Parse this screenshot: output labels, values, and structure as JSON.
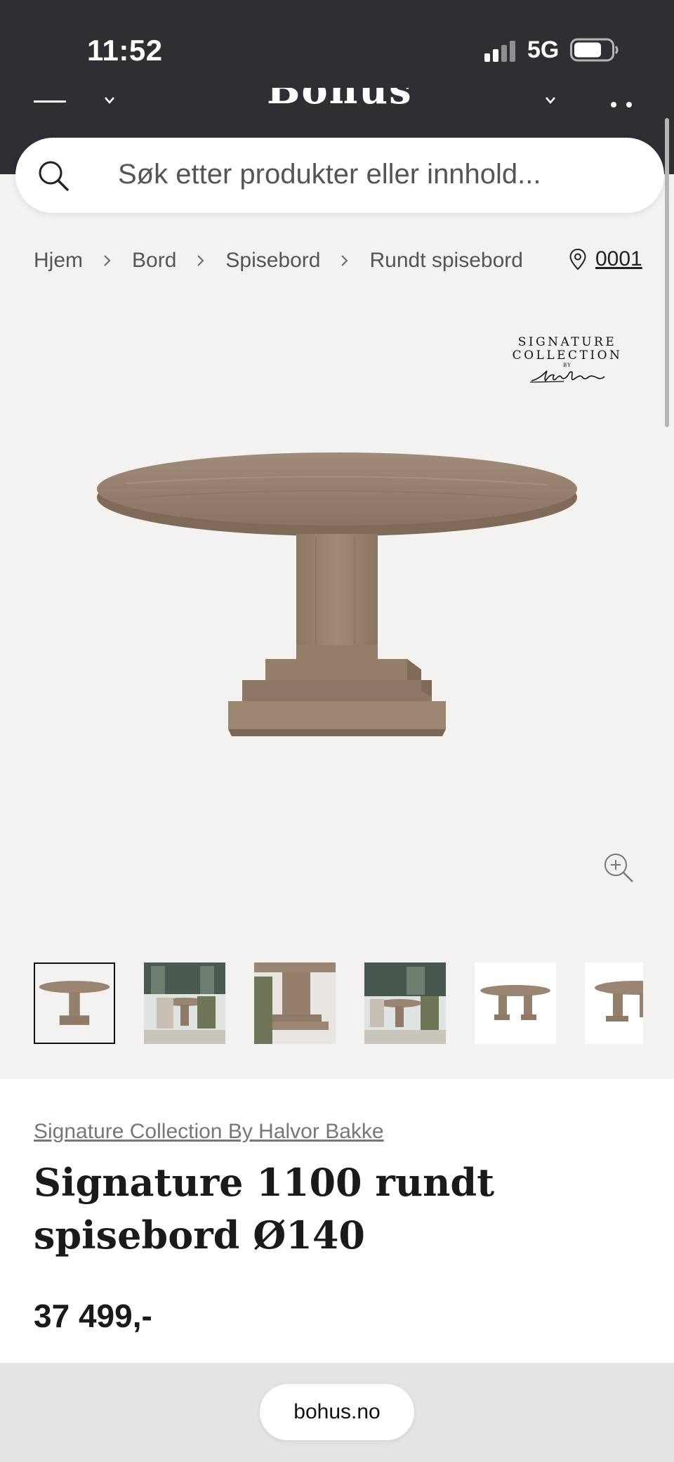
{
  "status_bar": {
    "time": "11:52",
    "network": "5G"
  },
  "nav": {
    "logo": "Bohus"
  },
  "search": {
    "placeholder": "Søk etter produkter eller innhold..."
  },
  "breadcrumb": {
    "items": [
      "Hjem",
      "Bord",
      "Spisebord",
      "Rundt spisebord"
    ]
  },
  "store": {
    "label": "0001"
  },
  "brand_logo": {
    "line1": "SIGNATURE",
    "line2": "COLLECTION",
    "line3": "BY",
    "signature": "Halvor Bakke"
  },
  "gallery": {
    "thumbnail_count": 6,
    "active_index": 0
  },
  "product": {
    "brand": "Signature Collection By Halvor Bakke",
    "title": "Signature 1100 rundt spisebord Ø140",
    "price": "37 499,-"
  },
  "browser": {
    "url": "bohus.no"
  },
  "colors": {
    "header_bg": "#2e2e33",
    "gallery_bg": "#f4f2f1",
    "wood": "#9a8572"
  }
}
